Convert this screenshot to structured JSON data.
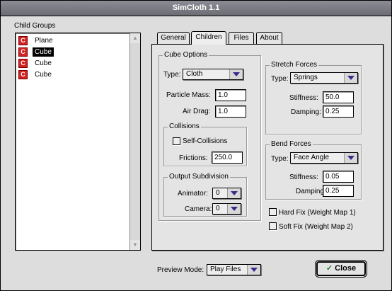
{
  "window": {
    "title": "SimCloth 1.1"
  },
  "child_groups": {
    "label": "Child Groups",
    "items": [
      {
        "icon": "red-c-icon",
        "label": "Plane",
        "selected": false
      },
      {
        "icon": "red-c-icon",
        "label": "Cube",
        "selected": true
      },
      {
        "icon": "red-c-icon",
        "label": "Cube",
        "selected": false
      },
      {
        "icon": "red-c-icon",
        "label": "Cube",
        "selected": false
      }
    ]
  },
  "tabs": [
    {
      "label": "General",
      "active": false
    },
    {
      "label": "Children",
      "active": true
    },
    {
      "label": "Files",
      "active": false
    },
    {
      "label": "About",
      "active": false
    }
  ],
  "cube_options": {
    "title": "Cube Options",
    "type_label": "Type:",
    "type_value": "Cloth",
    "particle_mass_label": "Particle Mass:",
    "particle_mass_value": "1.0",
    "air_drag_label": "Air Drag:",
    "air_drag_value": "1.0"
  },
  "collisions": {
    "title": "Collisions",
    "self_collisions_label": "Self-Collisions",
    "self_collisions_checked": false,
    "frictions_label": "Frictions:",
    "frictions_value": "250.0"
  },
  "output_subdivision": {
    "title": "Output Subdivision",
    "animator_label": "Animator:",
    "animator_value": "0",
    "camera_label": "Camera:",
    "camera_value": "0"
  },
  "stretch_forces": {
    "title": "Stretch Forces",
    "type_label": "Type:",
    "type_value": "Springs",
    "stiffness_label": "Stiffness:",
    "stiffness_value": "50.0",
    "damping_label": "Damping:",
    "damping_value": "0.25"
  },
  "bend_forces": {
    "title": "Bend Forces",
    "type_label": "Type:",
    "type_value": "Face Angle",
    "stiffness_label": "Stiffness:",
    "stiffness_value": "0.05",
    "damping_label": "Damping",
    "damping_value": "0.25"
  },
  "fixes": {
    "hard_fix_label": "Hard Fix (Weight Map 1)",
    "hard_fix_checked": false,
    "soft_fix_label": "Soft Fix (Weight Map 2)",
    "soft_fix_checked": false
  },
  "footer": {
    "preview_mode_label": "Preview Mode:",
    "preview_mode_value": "Play Files",
    "close_label": "Close",
    "close_icon": "checkmark-icon"
  }
}
